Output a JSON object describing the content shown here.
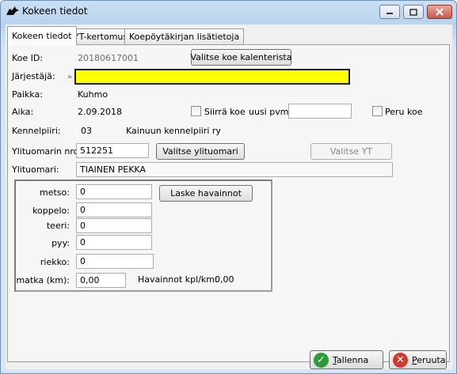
{
  "window": {
    "title": "Kokeen tiedot"
  },
  "tabs": [
    {
      "label": "Kokeen tiedot",
      "active": true
    },
    {
      "label": "YT-kertomus",
      "active": false
    },
    {
      "label": "Koepöytäkirjan lisätietoja",
      "active": false
    }
  ],
  "form": {
    "koe_id_label": "Koe ID:",
    "koe_id_value": "20180617001",
    "valitse_koe_button": "Valitse koe kalenterista",
    "jarjestaja_label": "Järjestäjä:",
    "jarjestaja_marker": "»",
    "jarjestaja_value": "",
    "paikka_label": "Paikka:",
    "paikka_value": "Kuhmo",
    "aika_label": "Aika:",
    "aika_value": "2.09.2018",
    "siirra_koe_label": "Siirrä koe",
    "uusi_pvm_label": "uusi pvm:",
    "uusi_pvm_value": "",
    "peru_koe_label": "Peru koe",
    "kennelpiiri_label": "Kennelpiiri:",
    "kennelpiiri_number": "03",
    "kennelpiiri_name": "Kainuun kennelpiiri ry",
    "ylituomari_nro_label": "Ylituomarin nro:",
    "ylituomari_nro_value": "512251",
    "valitse_ylituomari_button": "Valitse ylituomari",
    "valitse_yt_button": "Valitse YT",
    "ylituomari_label": "Ylituomari:",
    "ylituomari_value": "TIAINEN PEKKA"
  },
  "observations": {
    "metso_label": "metso:",
    "metso_value": "0",
    "laske_button": "Laske havainnot",
    "koppelo_label": "koppelo:",
    "koppelo_value": "0",
    "teeri_label": "teeri:",
    "teeri_value": "0",
    "pyy_label": "pyy:",
    "pyy_value": "0",
    "riekko_label": "riekko:",
    "riekko_value": "0",
    "matka_label": "matka (km):",
    "matka_value": "0,00",
    "havainnot_label": "Havainnot kpl/km:",
    "havainnot_value": "0,00"
  },
  "buttons": {
    "tallenna_underlined": "T",
    "tallenna_rest": "allenna",
    "peruuta_underlined": "P",
    "peruuta_rest": "eruuta"
  },
  "icons": {
    "app": "dog-icon",
    "minimize": "minimize-icon",
    "maximize": "maximize-icon",
    "close": "close-icon",
    "tallenna": "checkmark-icon",
    "peruuta": "cancel-icon"
  },
  "colors": {
    "highlight_field": "#ffff00",
    "tallenna_icon": "#2e9c3a",
    "peruuta_icon": "#d23a2e"
  }
}
